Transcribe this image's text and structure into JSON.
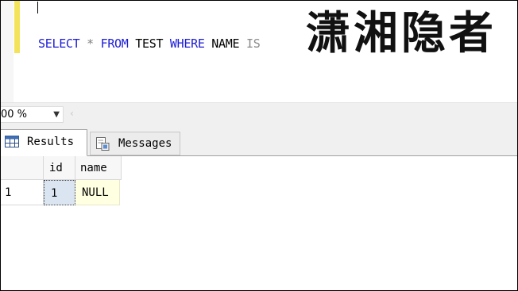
{
  "editor": {
    "sql_tokens": [
      {
        "text": "SELECT",
        "role": "keyword"
      },
      {
        "text": " ",
        "role": "plain"
      },
      {
        "text": "*",
        "role": "operator"
      },
      {
        "text": " ",
        "role": "plain"
      },
      {
        "text": "FROM",
        "role": "keyword"
      },
      {
        "text": " TEST ",
        "role": "plain"
      },
      {
        "text": "WHERE",
        "role": "keyword"
      },
      {
        "text": " NAME ",
        "role": "plain"
      },
      {
        "text": "IS",
        "role": "gray"
      }
    ],
    "watermark": "潇湘隐者"
  },
  "zoom": {
    "value": "00 %"
  },
  "tabs": [
    {
      "label": "Results",
      "icon": "grid-icon",
      "selected": true
    },
    {
      "label": "Messages",
      "icon": "document-icon",
      "selected": false
    }
  ],
  "grid": {
    "columns": [
      "id",
      "name"
    ],
    "rows": [
      {
        "rownum": "1",
        "id": "1",
        "name": "NULL"
      }
    ]
  },
  "colors": {
    "keyword": "#1b1bd6",
    "operator": "#7f7f7f",
    "change_bar": "#f2e35a",
    "selected_cell": "#dbe5f1",
    "null_cell": "#ffffe1"
  }
}
